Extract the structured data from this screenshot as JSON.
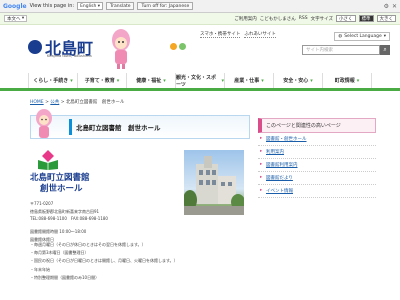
{
  "translate_bar": {
    "google": "Google",
    "view_label": "View this page in:",
    "language": "English",
    "translate_button": "Translate",
    "turn_off": "Turn off for: Japanese"
  },
  "strip": {
    "select_value": "本文へ",
    "links": [
      "ご利用案内",
      "こどもかしまさん",
      "RSS"
    ],
    "text_size_label": "文字サイズ",
    "text_sizes": [
      "小さく",
      "標準",
      "大きく"
    ]
  },
  "header": {
    "logo_name": "北島町",
    "logo_sub": "Kitajima town, Tokushima",
    "links": [
      "スマホ・携帯サイト",
      "ふれあいサイト"
    ],
    "language_select": "Select Language",
    "search_placeholder": "サイト内検索"
  },
  "nav": [
    "くらし・手続き",
    "子育て・教育",
    "健康・福祉",
    "観光・文化・スポーツ",
    "産業・仕事",
    "安全・安心",
    "町政情報"
  ],
  "breadcrumb": {
    "home": "HOME",
    "level1": "公共",
    "current": "北島町立図書館　創世ホール"
  },
  "page_title": "北島町立図書館　創世ホール",
  "lib_title": [
    "北島町立図書館",
    "創世ホール"
  ],
  "address": [
    "〒771-0207",
    "徳島県板野郡北島町新喜来字南古田91",
    "TEL:088-698-1100　FAX:088-698-1180"
  ],
  "hours": [
    "図書館開館時間 10:00～18:00",
    "図書館休館日"
  ],
  "closed_days": [
    "毎週月曜日（その日が休日のときはその翌日を休館します。）",
    "毎月第3木曜日（図書整理日）",
    "国民の祝日（その日が日曜日のときは開館し、月曜日、火曜日を休館します。）",
    "年末年始",
    "特別整理期間（図書館のみ10日間）"
  ],
  "sidebar": {
    "heading": "このページと関連性の高いページ",
    "items": [
      "図書館・創世ホール",
      "利用案内",
      "図書館利用案内",
      "図書館だより",
      "イベント情報"
    ]
  }
}
